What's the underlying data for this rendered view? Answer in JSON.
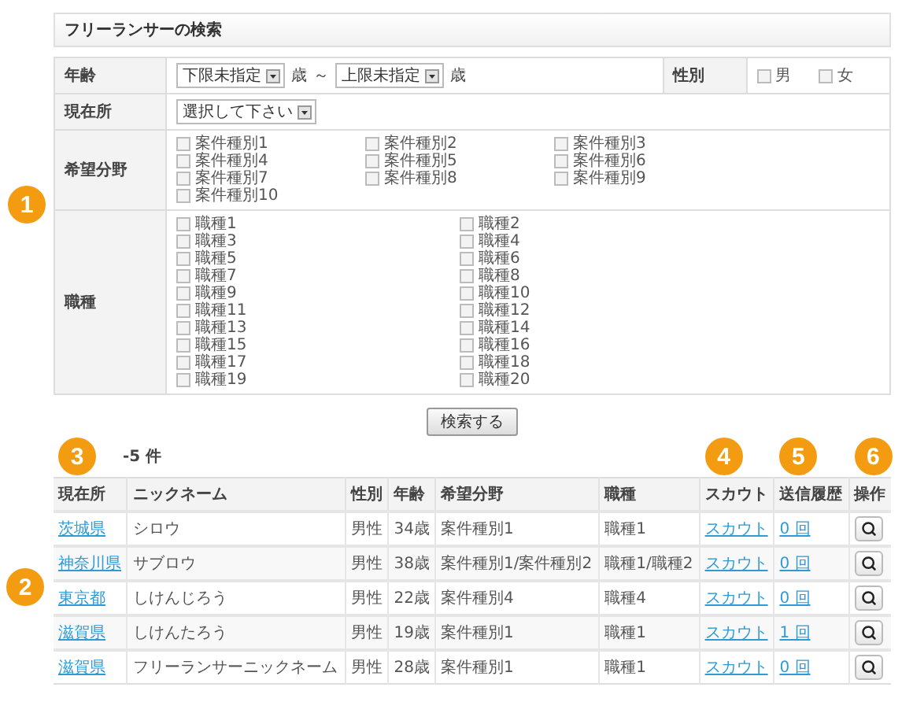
{
  "title": "フリーランサーの検索",
  "form": {
    "age": {
      "label": "年齢",
      "min": "下限未指定",
      "min_unit": "歳",
      "range_sep": "～",
      "max": "上限未指定",
      "max_unit": "歳"
    },
    "gender": {
      "label": "性別",
      "options": [
        {
          "label": "男",
          "checked": false
        },
        {
          "label": "女",
          "checked": false
        }
      ]
    },
    "location": {
      "label": "現在所",
      "value": "選択して下さい"
    },
    "fields": {
      "label": "希望分野",
      "options": [
        {
          "label": "案件種別1",
          "checked": false
        },
        {
          "label": "案件種別2",
          "checked": false
        },
        {
          "label": "案件種別3",
          "checked": false
        },
        {
          "label": "案件種別4",
          "checked": false
        },
        {
          "label": "案件種別5",
          "checked": false
        },
        {
          "label": "案件種別6",
          "checked": false
        },
        {
          "label": "案件種別7",
          "checked": false
        },
        {
          "label": "案件種別8",
          "checked": false
        },
        {
          "label": "案件種別9",
          "checked": false
        },
        {
          "label": "案件種別10",
          "checked": false
        }
      ]
    },
    "jobs": {
      "label": "職種",
      "options": [
        {
          "label": "職種1",
          "checked": false
        },
        {
          "label": "職種2",
          "checked": false
        },
        {
          "label": "職種3",
          "checked": false
        },
        {
          "label": "職種4",
          "checked": false
        },
        {
          "label": "職種5",
          "checked": false
        },
        {
          "label": "職種6",
          "checked": false
        },
        {
          "label": "職種7",
          "checked": false
        },
        {
          "label": "職種8",
          "checked": false
        },
        {
          "label": "職種9",
          "checked": false
        },
        {
          "label": "職種10",
          "checked": false
        },
        {
          "label": "職種11",
          "checked": false
        },
        {
          "label": "職種12",
          "checked": false
        },
        {
          "label": "職種13",
          "checked": false
        },
        {
          "label": "職種14",
          "checked": false
        },
        {
          "label": "職種15",
          "checked": false
        },
        {
          "label": "職種16",
          "checked": false
        },
        {
          "label": "職種17",
          "checked": false
        },
        {
          "label": "職種18",
          "checked": false
        },
        {
          "label": "職種19",
          "checked": false
        },
        {
          "label": "職種20",
          "checked": false
        }
      ]
    }
  },
  "search_button": "検索する",
  "result_count": "-5 件",
  "callouts": [
    {
      "label": "1"
    },
    {
      "label": "2"
    },
    {
      "label": "3"
    },
    {
      "label": "4"
    },
    {
      "label": "5"
    },
    {
      "label": "6"
    }
  ],
  "table": {
    "columns": [
      "現在所",
      "ニックネーム",
      "性別",
      "年齢",
      "希望分野",
      "職種",
      "スカウト",
      "送信履歴",
      "操作"
    ],
    "rows": [
      {
        "location": "茨城県",
        "nickname": "シロウ",
        "gender": "男性",
        "age": "34歳",
        "field": "案件種別1",
        "job": "職種1",
        "scout": "スカウト",
        "history": "0 回"
      },
      {
        "location": "神奈川県",
        "nickname": "サブロウ",
        "gender": "男性",
        "age": "38歳",
        "field": "案件種別1/案件種別2",
        "job": "職種1/職種2",
        "scout": "スカウト",
        "history": "0 回"
      },
      {
        "location": "東京都",
        "nickname": "しけんじろう",
        "gender": "男性",
        "age": "22歳",
        "field": "案件種別4",
        "job": "職種4",
        "scout": "スカウト",
        "history": "0 回"
      },
      {
        "location": "滋賀県",
        "nickname": "しけんたろう",
        "gender": "男性",
        "age": "19歳",
        "field": "案件種別1",
        "job": "職種1",
        "scout": "スカウト",
        "history": "1 回"
      },
      {
        "location": "滋賀県",
        "nickname": "フリーランサーニックネーム",
        "gender": "男性",
        "age": "28歳",
        "field": "案件種別1",
        "job": "職種1",
        "scout": "スカウト",
        "history": "0 回"
      }
    ]
  }
}
